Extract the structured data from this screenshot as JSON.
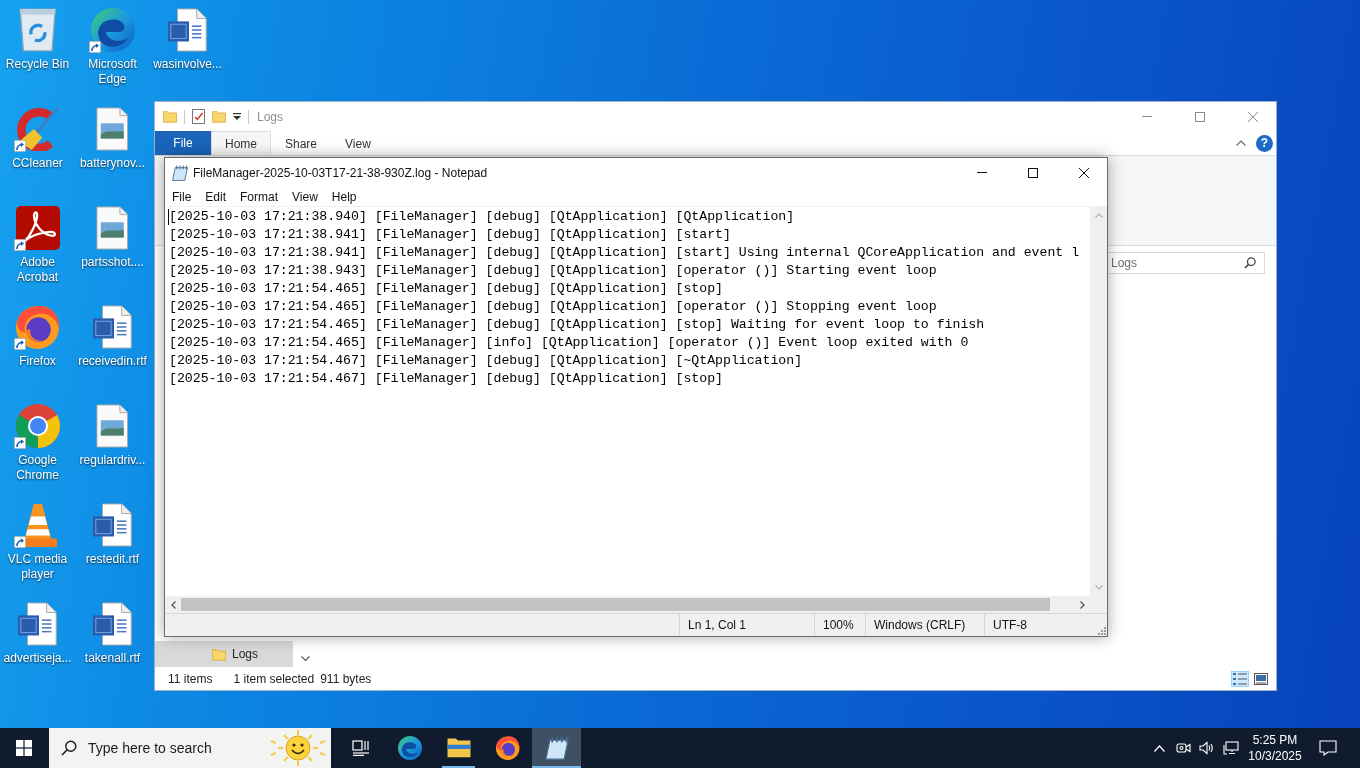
{
  "desktop_icons": [
    {
      "label": "Recycle Bin",
      "kind": "recycle-bin",
      "shortcut": false
    },
    {
      "label": "CCleaner",
      "kind": "ccleaner",
      "shortcut": true
    },
    {
      "label": "Adobe Acrobat",
      "kind": "acrobat",
      "shortcut": true
    },
    {
      "label": "Firefox",
      "kind": "firefox",
      "shortcut": true
    },
    {
      "label": "Google Chrome",
      "kind": "chrome",
      "shortcut": true
    },
    {
      "label": "VLC media player",
      "kind": "vlc",
      "shortcut": true
    },
    {
      "label": "advertiseja...",
      "kind": "word",
      "shortcut": false
    },
    {
      "label": "Microsoft Edge",
      "kind": "edge",
      "shortcut": true
    },
    {
      "label": "batterynov...",
      "kind": "image",
      "shortcut": false
    },
    {
      "label": "partsshot....",
      "kind": "image",
      "shortcut": false
    },
    {
      "label": "receivedin.rtf",
      "kind": "word",
      "shortcut": false
    },
    {
      "label": "regulardriv...",
      "kind": "image",
      "shortcut": false
    },
    {
      "label": "restedit.rtf",
      "kind": "word",
      "shortcut": false
    },
    {
      "label": "takenall.rtf",
      "kind": "word",
      "shortcut": false
    },
    {
      "label": "wasinvolve...",
      "kind": "word",
      "shortcut": false
    }
  ],
  "explorer": {
    "title": "Logs",
    "ribbon_tabs": [
      {
        "label": "File",
        "kind": "menu",
        "selected": false
      },
      {
        "label": "Home",
        "kind": "tab",
        "selected": true
      },
      {
        "label": "Share",
        "kind": "tab",
        "selected": false
      },
      {
        "label": "View",
        "kind": "tab",
        "selected": false
      }
    ],
    "help": "?",
    "search": {
      "placeholder": "Logs"
    },
    "navigation": [
      {
        "label": "Logs",
        "selected": true
      }
    ],
    "status_bar": {
      "item_count": "11 items",
      "selection": "1 item selected",
      "size": "911 bytes"
    },
    "view_buttons": [
      {
        "kind": "details",
        "selected": true
      },
      {
        "kind": "large-icons",
        "selected": false
      }
    ]
  },
  "notepad": {
    "title": "FileManager-2025-10-03T17-21-38-930Z.log - Notepad",
    "menu": [
      "File",
      "Edit",
      "Format",
      "View",
      "Help"
    ],
    "lines": [
      "[2025-10-03 17:21:38.940] [FileManager] [debug] [QtApplication] [QtApplication]",
      "[2025-10-03 17:21:38.941] [FileManager] [debug] [QtApplication] [start]",
      "[2025-10-03 17:21:38.941] [FileManager] [debug] [QtApplication] [start] Using internal QCoreApplication and event l",
      "[2025-10-03 17:21:38.943] [FileManager] [debug] [QtApplication] [operator ()] Starting event loop",
      "[2025-10-03 17:21:54.465] [FileManager] [debug] [QtApplication] [stop]",
      "[2025-10-03 17:21:54.465] [FileManager] [debug] [QtApplication] [operator ()] Stopping event loop",
      "[2025-10-03 17:21:54.465] [FileManager] [debug] [QtApplication] [stop] Waiting for event loop to finish",
      "[2025-10-03 17:21:54.465] [FileManager] [info] [QtApplication] [operator ()] Event loop exited with 0",
      "[2025-10-03 17:21:54.467] [FileManager] [debug] [QtApplication] [~QtApplication]",
      "[2025-10-03 17:21:54.467] [FileManager] [debug] [QtApplication] [stop]"
    ],
    "status_bar": [
      "Ln 1, Col 1",
      "100%",
      "Windows (CRLF)",
      "UTF-8"
    ]
  },
  "taskbar": {
    "search": {
      "placeholder": "Type here to search"
    },
    "apps": [
      {
        "kind": "edge",
        "running": false,
        "active": false
      },
      {
        "kind": "file-explorer",
        "running": true,
        "active": false
      },
      {
        "kind": "firefox",
        "running": false,
        "active": false
      },
      {
        "kind": "notepad",
        "running": true,
        "active": true
      }
    ],
    "clock": {
      "time": "5:25 PM",
      "date": "10/3/2025"
    }
  }
}
